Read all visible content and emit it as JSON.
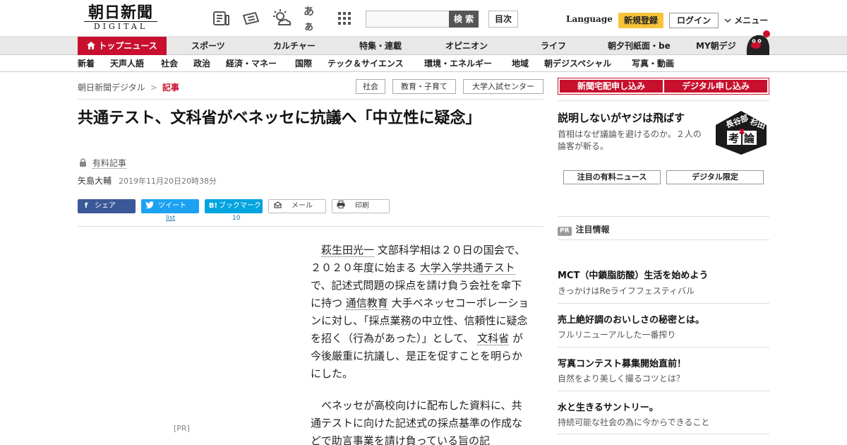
{
  "header": {
    "logo_jp": "朝日新聞",
    "logo_en": "DIGITAL",
    "font_size_icon_label": "あぁ",
    "search_button": "検 索",
    "toc_button": "目次",
    "language": "Language",
    "signup": "新規登録",
    "login": "ログイン",
    "menu": "メニュー"
  },
  "nav_primary": {
    "top_news": "トップニュース",
    "items": [
      "スポーツ",
      "カルチャー",
      "特集・連載",
      "オピニオン",
      "ライフ",
      "朝夕刊紙面・be",
      "MY朝デジ"
    ]
  },
  "nav_secondary": {
    "items": [
      "新着",
      "天声人語",
      "社会",
      "政治",
      "経済・マネー",
      "国際",
      "テック＆サイエンス",
      "環境・エネルギー",
      "地域",
      "朝デジスペシャル",
      "写真・動画"
    ]
  },
  "breadcrumb": {
    "home": "朝日新聞デジタル",
    "separator": ">",
    "current": "記事"
  },
  "tags": [
    "社会",
    "教育・子育て",
    "大学入試センター"
  ],
  "article": {
    "title": "共通テスト、文科省がベネッセに抗議へ「中立性に疑念」",
    "paid_label": "有料記事",
    "author": "矢島大輔",
    "date": "2019年11月20日20時38分",
    "share": {
      "facebook": "シェア",
      "twitter": "ツイート",
      "twitter_count": "list",
      "hatena": "ブックマーク",
      "hatena_count": "10",
      "mail": "メール",
      "print": "印刷"
    },
    "pr_label": "[PR]",
    "p1": {
      "link1": "萩生田光一",
      "t1": "文部科学相は２０日の国会で、２０２０年度に始まる",
      "link2": "大学入学共通テスト",
      "t2": "で、記述式問題の採点を請け負う会社を傘下に持つ",
      "link3": "通信教育",
      "t3": "大手ベネッセコーポレーションに対し、「採点業務の中立性、信頼性に疑念を招く（行為があった）」として、",
      "link4": "文科省",
      "t4": "が今後厳重に抗議し、是正を促すことを明らかにした。"
    },
    "p2": "ベネッセが高校向けに配布した資料に、共通テストに向けた記述式の採点基準の作成などで助言事業を請け負っている旨の記"
  },
  "sidebar": {
    "promo": [
      "新聞宅配申し込み",
      "デジタル申し込み"
    ],
    "feature_title": "説明しないがヤジは飛ばす",
    "feature_desc": "首相はなぜ議論を避けるのか。２人の論客が斬る。",
    "feature_image_text": [
      "長谷部",
      "杉田",
      "考",
      "論"
    ],
    "buttons": [
      "注目の有料ニュース",
      "デジタル限定"
    ],
    "pr_badge": "PR",
    "pr_heading": "注目情報",
    "ads": [
      {
        "title": "MCT（中鎖脂肪酸）生活を始めよう",
        "sub": "きっかけはReライフフェスティバル"
      },
      {
        "title": "売上絶好調のおいしさの秘密とは。",
        "sub": "フルリニューアルした一番搾り"
      },
      {
        "title": "写真コンテスト募集開始直前！",
        "sub": "自然をより美しく撮るコツとは？"
      },
      {
        "title": "水と生きるサントリー。",
        "sub": "持続可能な社会の為に今からできること"
      }
    ]
  },
  "colors": {
    "brand_red": "#c8102e",
    "signup_yellow": "#f6c33b",
    "facebook": "#3b5998",
    "twitter": "#1da1f2",
    "hatena": "#00a4de"
  }
}
